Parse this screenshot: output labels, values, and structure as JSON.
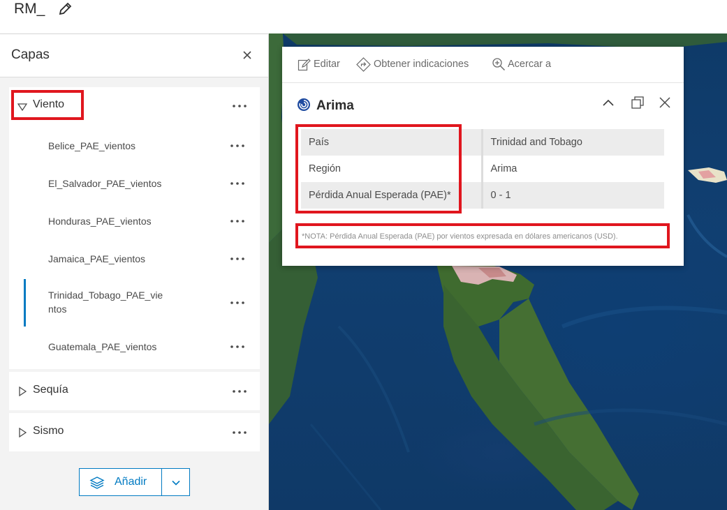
{
  "app": {
    "title": "RM_"
  },
  "layers_panel": {
    "title": "Capas",
    "groups": [
      {
        "label": "Viento",
        "expanded": true,
        "items": [
          {
            "label": "Belice_PAE_vientos"
          },
          {
            "label": "El_Salvador_PAE_vientos"
          },
          {
            "label": "Honduras_PAE_vientos"
          },
          {
            "label": "Jamaica_PAE_vientos"
          },
          {
            "label": "Trinidad_Tobago_PAE_vie ntos",
            "line1": "Trinidad_Tobago_PAE_vie",
            "line2": "ntos",
            "active": true
          },
          {
            "label": "Guatemala_PAE_vientos"
          }
        ]
      },
      {
        "label": "Sequía",
        "expanded": false
      },
      {
        "label": "Sismo",
        "expanded": false
      }
    ],
    "add_button_label": "Añadir"
  },
  "popup": {
    "toolbar": {
      "edit_label": "Editar",
      "directions_label": "Obtener indicaciones",
      "zoom_label": "Acercar a"
    },
    "title": "Arima",
    "fields": [
      {
        "key": "País",
        "value": "Trinidad and Tobago"
      },
      {
        "key": "Región",
        "value": "Arima"
      },
      {
        "key": "Pérdida Anual Esperada (PAE)*",
        "value": "0 - 1"
      }
    ],
    "note": "*NOTA: Pérdida Anual Esperada (PAE) por vientos expresada en dólares americanos (USD)."
  },
  "colors": {
    "accent": "#007ac2",
    "highlight_red": "#e0161e",
    "ocean": "#123f72",
    "land": "#3e6b3a"
  }
}
